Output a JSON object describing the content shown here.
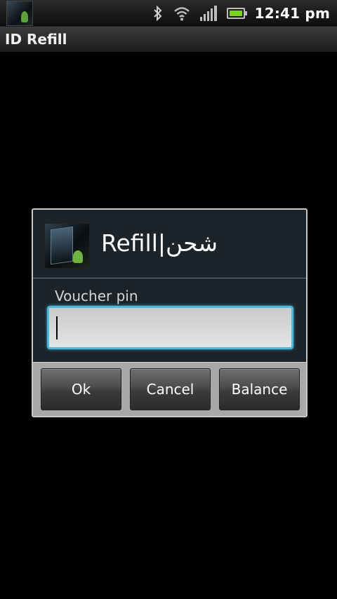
{
  "status_bar": {
    "time": "12:41 pm",
    "icons": [
      "app-notification-icon",
      "bluetooth-icon",
      "wifi-icon",
      "signal-icon",
      "battery-icon"
    ],
    "battery_level": 1.0
  },
  "app": {
    "title": "ID Refill"
  },
  "dialog": {
    "title": "Refill|شحن",
    "icon": "app-logo-icon",
    "field_label": "Voucher pin",
    "input_value": "",
    "input_placeholder": "",
    "buttons": {
      "ok": "Ok",
      "cancel": "Cancel",
      "balance": "Balance"
    }
  },
  "colors": {
    "background": "#000000",
    "dialog_bg": "#1c2329",
    "input_focus": "#4fb7d8",
    "button_bar": "#a8a8a8"
  }
}
